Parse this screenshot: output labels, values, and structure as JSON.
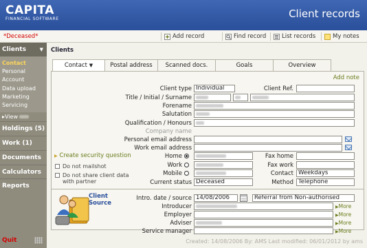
{
  "header": {
    "brand": "CAPITA",
    "brand_sub": "FINANCIAL SOFTWARE",
    "title": "Client records"
  },
  "toolbar": {
    "status_tag": "*Deceased*",
    "add_record": "Add record",
    "find_record": "Find record",
    "list_records": "List records",
    "my_notes": "My notes"
  },
  "sidebar": {
    "clients": "Clients",
    "subitems": [
      "Contact",
      "Personal",
      "Account",
      "Data upload",
      "Marketing",
      "Servicing"
    ],
    "view": "View",
    "items": [
      "Holdings (5)",
      "Work (1)",
      "Documents",
      "Calculators",
      "Reports"
    ],
    "quit": "Quit"
  },
  "main": {
    "breadcrumb": "Clients",
    "tabs": [
      "Contact",
      "Postal address",
      "Scanned docs.",
      "Goals",
      "Overview"
    ],
    "add_note": "Add note"
  },
  "form": {
    "client_type_label": "Client type",
    "client_type_value": "Individual",
    "client_ref_label": "Client Ref.",
    "title_label": "Title / Initial / Surname",
    "forename_label": "Forename",
    "salutation_label": "Salutation",
    "qualification_label": "Qualification / Honours",
    "company_name_label": "Company name",
    "personal_email_label": "Personal email address",
    "work_email_label": "Work email address",
    "home_label": "Home",
    "work_label": "Work",
    "mobile_label": "Mobile",
    "current_status_label": "Current status",
    "current_status_value": "Deceased",
    "fax_home_label": "Fax home",
    "fax_work_label": "Fax work",
    "contact_label": "Contact",
    "contact_value": "Weekdays",
    "method_label": "Method",
    "method_value": "Telephone",
    "create_security_question": "Create security question",
    "do_not_mailshot": "Do not mailshot",
    "do_not_share_line1": "Do not share client data",
    "do_not_share_line2": "with partner"
  },
  "source": {
    "heading_line1": "Client",
    "heading_line2": "Source",
    "intro_label": "Intro. date / source",
    "intro_date": "14/08/2006",
    "intro_source": "Referral from Non-authorised",
    "introducer_label": "Introducer",
    "employer_label": "Employer",
    "adviser_label": "Adviser",
    "service_manager_label": "Service manager",
    "more": "More"
  },
  "footer": {
    "text": "Created: 14/08/2006  By: AMS Last modified: 06/01/2012 by ams"
  },
  "colors": {
    "header_blue": "#3f67b3",
    "sidebar": "#8f8c7e",
    "active_subitem": "#ffd65a",
    "deceased_red": "#d40000",
    "link_green": "#6b7d1f"
  }
}
